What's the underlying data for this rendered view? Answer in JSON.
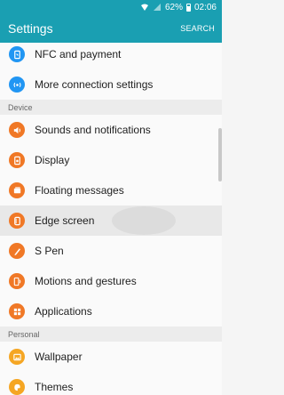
{
  "status": {
    "battery": "62%",
    "time": "02:06"
  },
  "appbar": {
    "title": "Settings",
    "search": "SEARCH"
  },
  "colors": {
    "accent": "#1a9fb2",
    "blue": "#2196f3",
    "orange": "#f07826",
    "amber": "#f5a623"
  },
  "rows": [
    {
      "label": "NFC and payment",
      "icon": "nfc-icon"
    },
    {
      "label": "More connection settings",
      "icon": "connection-icon"
    },
    {
      "label": "Sounds and notifications",
      "icon": "sound-icon"
    },
    {
      "label": "Display",
      "icon": "display-icon"
    },
    {
      "label": "Floating messages",
      "icon": "floating-messages-icon"
    },
    {
      "label": "Edge screen",
      "icon": "edge-screen-icon"
    },
    {
      "label": "S Pen",
      "icon": "s-pen-icon"
    },
    {
      "label": "Motions and gestures",
      "icon": "motions-icon"
    },
    {
      "label": "Applications",
      "icon": "applications-icon"
    },
    {
      "label": "Wallpaper",
      "icon": "wallpaper-icon"
    },
    {
      "label": "Themes",
      "icon": "themes-icon"
    }
  ],
  "sections": {
    "device": "Device",
    "personal": "Personal"
  }
}
